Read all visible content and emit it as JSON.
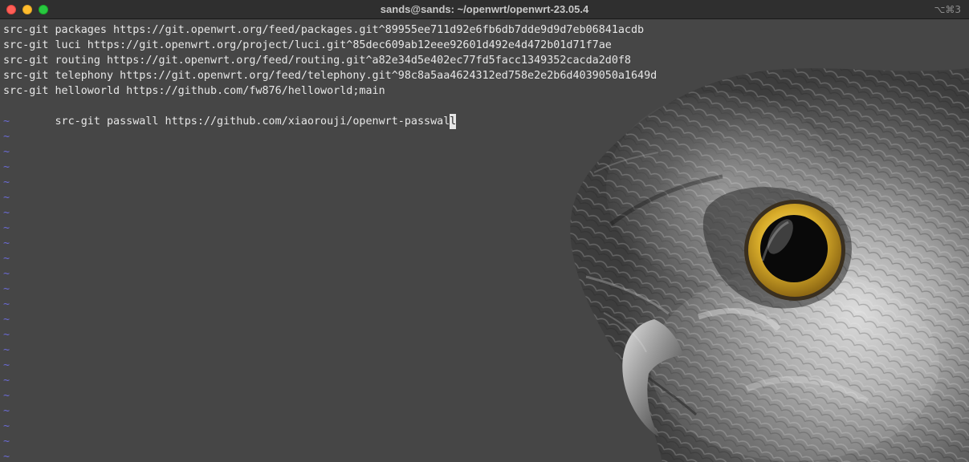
{
  "window": {
    "title": "sands@sands: ~/openwrt/openwrt-23.05.4",
    "shortcut": "⌥⌘3"
  },
  "terminal": {
    "lines": [
      "src-git packages https://git.openwrt.org/feed/packages.git^89955ee711d92e6fb6db7dde9d9d7eb06841acdb",
      "src-git luci https://git.openwrt.org/project/luci.git^85dec609ab12eee92601d492e4d472b01d71f7ae",
      "src-git routing https://git.openwrt.org/feed/routing.git^a82e34d5e402ec77fd5facc1349352cacda2d0f8",
      "src-git telephony https://git.openwrt.org/feed/telephony.git^98c8a5aa4624312ed758e2e2b6d4039050a1649d",
      "src-git helloworld https://github.com/fw876/helloworld;main"
    ],
    "cursor_line_before": "src-git passwall https://github.com/xiaorouji/openwrt-passwal",
    "cursor_char": "l",
    "empty_marker": "~",
    "empty_line_count": 23
  },
  "colors": {
    "background": "#464646",
    "text": "#e7e7e7",
    "tilde": "#6b6bd6",
    "titlebar": "#2f2f2f"
  }
}
